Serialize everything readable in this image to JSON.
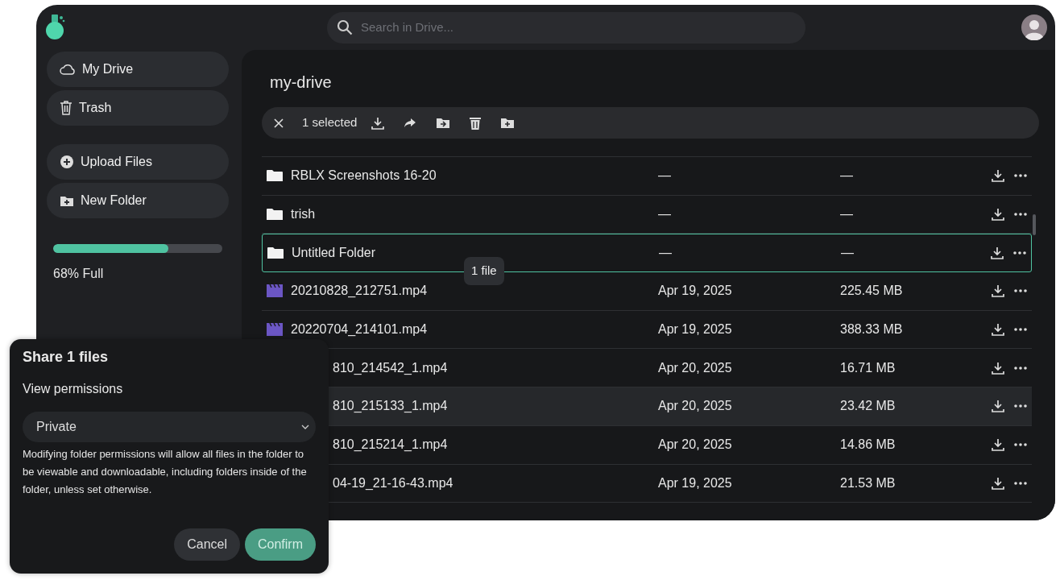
{
  "search": {
    "placeholder": "Search in Drive..."
  },
  "sidebar": {
    "items": [
      {
        "label": "My Drive",
        "kind": "drive"
      },
      {
        "label": "Trash",
        "kind": "trash"
      },
      {
        "label": "Upload Files",
        "kind": "upload"
      },
      {
        "label": "New Folder",
        "kind": "folder"
      }
    ],
    "storage": {
      "level": 0.68,
      "label": "68% Full"
    }
  },
  "main": {
    "title": "my-drive",
    "toolbar": {
      "count": "1 selected"
    },
    "rows": [
      {
        "name": "RBLX Screenshots 16-20",
        "kind": "folder",
        "modified": "—",
        "size": "—",
        "selected": false,
        "hovered": false,
        "partly_hidden": false
      },
      {
        "name": "trish",
        "kind": "folder",
        "modified": "—",
        "size": "—",
        "selected": false,
        "hovered": false,
        "partly_hidden": false
      },
      {
        "name": "Untitled Folder",
        "kind": "folder",
        "modified": "—",
        "size": "—",
        "selected": true,
        "hovered": false,
        "partly_hidden": false
      },
      {
        "name": "20210828_212751.mp4",
        "kind": "video",
        "modified": "Apr 19, 2025",
        "size": "225.45 MB",
        "selected": false,
        "hovered": false,
        "partly_hidden": false
      },
      {
        "name": "20220704_214101.mp4",
        "kind": "video",
        "modified": "Apr 19, 2025",
        "size": "388.33 MB",
        "selected": false,
        "hovered": false,
        "partly_hidden": false
      },
      {
        "name": "810_214542_1.mp4",
        "modified": "Apr 20, 2025",
        "size": "16.71 MB",
        "selected": false,
        "hovered": false,
        "partly_hidden": true
      },
      {
        "name": "810_215133_1.mp4",
        "modified": "Apr 20, 2025",
        "size": "23.42 MB",
        "selected": false,
        "hovered": true,
        "partly_hidden": true
      },
      {
        "name": "810_215214_1.mp4",
        "modified": "Apr 20, 2025",
        "size": "14.86 MB",
        "selected": false,
        "hovered": false,
        "partly_hidden": true
      },
      {
        "name": "04-19_21-16-43.mp4",
        "modified": "Apr 19, 2025",
        "size": "21.53 MB",
        "selected": false,
        "hovered": false,
        "partly_hidden": true
      }
    ],
    "tooltip": "1 file"
  },
  "dialog": {
    "title": "Share 1 files",
    "label": "View permissions",
    "value": "Private",
    "note": "Modifying folder permissions will allow all files in the folder to be viewable and downloadable, including folders inside of the folder, unless set otherwise.",
    "buttons": [
      {
        "label": "Cancel",
        "kind": "secondary"
      },
      {
        "label": "Confirm",
        "kind": "primary"
      }
    ]
  }
}
